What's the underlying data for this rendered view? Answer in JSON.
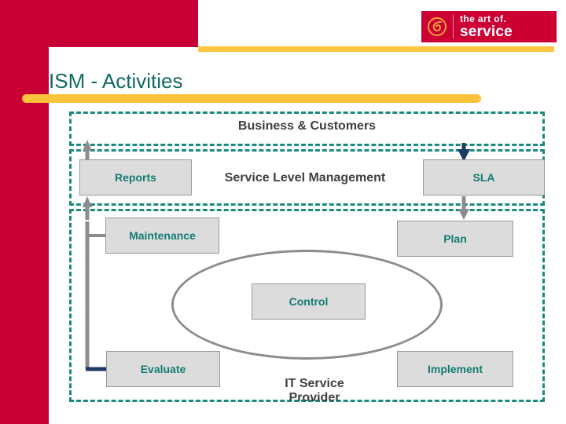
{
  "slide": {
    "title": "ISM - Activities"
  },
  "logo": {
    "mark": "swirl-icon",
    "line1": "the art of.",
    "line2": "service"
  },
  "colors": {
    "red": "#C80036",
    "logo_red": "#CC0033",
    "yellow": "#FBC33C",
    "teal_text": "#137C72",
    "teal_dash": "#1A8A7E",
    "title_teal": "#136A62",
    "node_fill": "#DCDCDC",
    "node_border": "#9A9A9A",
    "gray_arrow": "#8C8C8C",
    "navy_arrow": "#1F3864",
    "zone_label": "#404040"
  },
  "diagram": {
    "zones": [
      {
        "id": "business-customers",
        "label": "Business & Customers"
      },
      {
        "id": "service-level-management",
        "label": "Service Level Management"
      },
      {
        "id": "it-service-provider",
        "label": "IT Service\nProvider"
      }
    ],
    "nodes": [
      {
        "id": "reports",
        "label": "Reports"
      },
      {
        "id": "sla",
        "label": "SLA"
      },
      {
        "id": "maintenance",
        "label": "Maintenance"
      },
      {
        "id": "plan",
        "label": "Plan"
      },
      {
        "id": "control",
        "label": "Control"
      },
      {
        "id": "evaluate",
        "label": "Evaluate"
      },
      {
        "id": "implement",
        "label": "Implement"
      }
    ],
    "cycle_shape": "ellipse"
  }
}
